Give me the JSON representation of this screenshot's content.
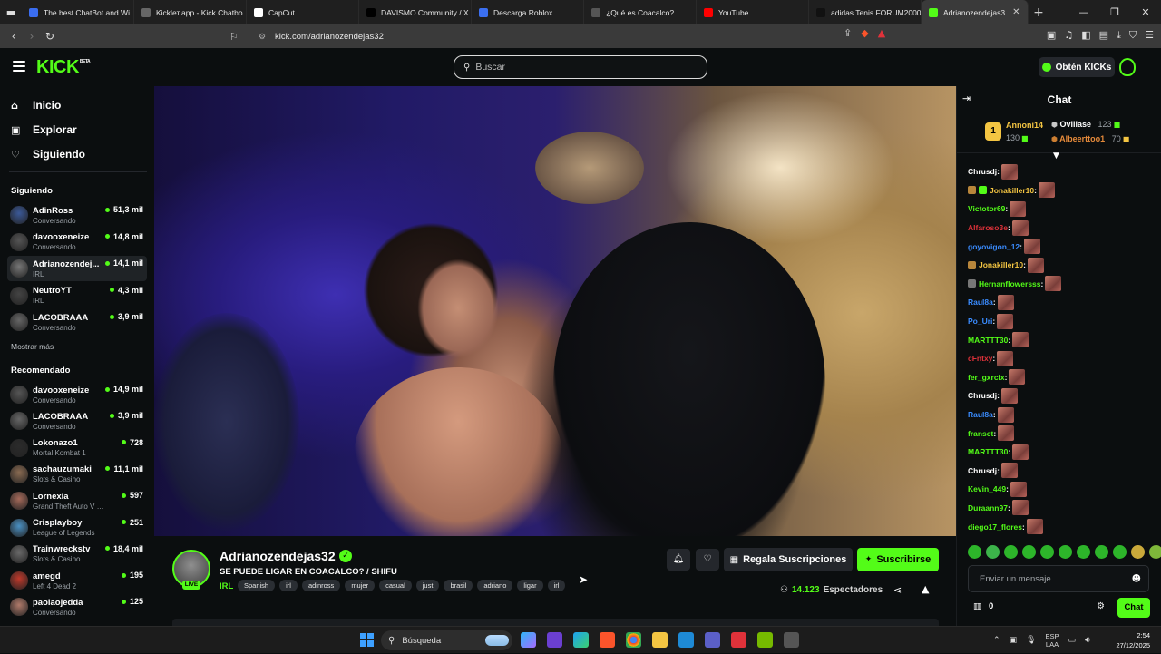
{
  "browser": {
    "tabs": [
      {
        "label": "The best ChatBot and Wi",
        "icon": "shield-icon",
        "color": "#3a6df0"
      },
      {
        "label": "Kickleт.app - Kick Chatbo",
        "icon": "kickletapp-icon",
        "color": "#666666"
      },
      {
        "label": "CapCut",
        "icon": "capcut-icon",
        "color": "#ffffff"
      },
      {
        "label": "DAVISMO Community / X",
        "icon": "x-icon",
        "color": "#000000"
      },
      {
        "label": "Descarga Roblox",
        "icon": "roblox-icon",
        "color": "#3b6ff0"
      },
      {
        "label": "¿Qué es Coacalco?",
        "icon": "globe-icon",
        "color": "#555555"
      },
      {
        "label": "YouTube",
        "icon": "youtube-icon",
        "color": "#ff0000"
      },
      {
        "label": "adidas Tenis FORUM2000",
        "icon": "adidas-icon",
        "color": "#111111"
      },
      {
        "label": "Adrianozendejas3",
        "icon": "kick-icon",
        "color": "#53fc18"
      }
    ],
    "url": "kick.com/adrianozendejas32"
  },
  "header": {
    "logo": "KICK",
    "logo_sup": "BETA",
    "search_placeholder": "Buscar",
    "kicks_label": "Obtén KICKs"
  },
  "sidebar": {
    "nav": [
      {
        "label": "Inicio",
        "icon": "home-icon"
      },
      {
        "label": "Explorar",
        "icon": "compass-icon"
      },
      {
        "label": "Siguiendo",
        "icon": "heart-icon"
      }
    ],
    "following_title": "Siguiendo",
    "following": [
      {
        "name": "AdinRoss",
        "category": "Conversando",
        "viewers": "51,3 mil",
        "avatar": "#3b5998"
      },
      {
        "name": "davooxeneize",
        "category": "Conversando",
        "viewers": "14,8 mil",
        "avatar": "#555555"
      },
      {
        "name": "Adrianozendej...",
        "category": "IRL",
        "viewers": "14,1 mil",
        "avatar": "#777777"
      },
      {
        "name": "NeutroYT",
        "category": "IRL",
        "viewers": "4,3 mil",
        "avatar": "#444444"
      },
      {
        "name": "LACOBRAAA",
        "category": "Conversando",
        "viewers": "3,9 mil",
        "avatar": "#666666"
      }
    ],
    "show_more": "Mostrar más",
    "recommended_title": "Recomendado",
    "recommended": [
      {
        "name": "davooxeneize",
        "category": "Conversando",
        "viewers": "14,9 mil",
        "avatar": "#555555"
      },
      {
        "name": "LACOBRAAA",
        "category": "Conversando",
        "viewers": "3,9 mil",
        "avatar": "#666666"
      },
      {
        "name": "Lokonazo1",
        "category": "Mortal Kombat 1",
        "viewers": "728",
        "avatar": "#2b2b2b"
      },
      {
        "name": "sachauzumaki",
        "category": "Slots & Casino",
        "viewers": "11,1 mil",
        "avatar": "#8a6b52"
      },
      {
        "name": "Lornexia",
        "category": "Grand Theft Auto V (G...",
        "viewers": "597",
        "avatar": "#a56a5a"
      },
      {
        "name": "Crisplayboy",
        "category": "League of Legends",
        "viewers": "251",
        "avatar": "#4a90c2"
      },
      {
        "name": "Trainwreckstv",
        "category": "Slots & Casino",
        "viewers": "18,4 mil",
        "avatar": "#6a6a6a"
      },
      {
        "name": "amegd",
        "category": "Left 4 Dead 2",
        "viewers": "195",
        "avatar": "#c0392b"
      },
      {
        "name": "paolaojedda",
        "category": "Conversando",
        "viewers": "125",
        "avatar": "#b07a6a"
      }
    ]
  },
  "stream": {
    "streamer": "Adrianozendejas32",
    "title": "SE PUEDE LIGAR EN COACALCO? / SHIFU",
    "category": "IRL",
    "live_label": "LIVE",
    "tags": [
      "Spanish",
      "irl",
      "adinross",
      "mujer",
      "casual",
      "just",
      "brasil",
      "adriano",
      "ligar",
      "irl"
    ],
    "gift_label": "Regala Suscripciones",
    "subscribe_label": "Suscribirse",
    "viewers": "14.123",
    "viewers_label": "Espectadores"
  },
  "chat": {
    "title": "Chat",
    "leaderboard": {
      "rank": "1",
      "first": {
        "name": "Annoni14",
        "value": "130"
      },
      "second": {
        "name": "Ovillase",
        "value": "123"
      },
      "third": {
        "name": "Albeerttoo1",
        "value": "70"
      }
    },
    "messages": [
      {
        "user": "Chrusdj",
        "color": "#ffffff",
        "badges": []
      },
      {
        "user": "Jonakiller10",
        "color": "#f4c542",
        "badges": [
          "#b8863b",
          "#53fc18"
        ]
      },
      {
        "user": "Victotor69",
        "color": "#53fc18",
        "badges": []
      },
      {
        "user": "Alfaroso3e",
        "color": "#e0323a",
        "badges": []
      },
      {
        "user": "goyovigon_12",
        "color": "#3a8cff",
        "badges": []
      },
      {
        "user": "Jonakiller10",
        "color": "#f4c542",
        "badges": [
          "#b8863b"
        ]
      },
      {
        "user": "Hernanflowersss",
        "color": "#53fc18",
        "badges": [
          "#777777"
        ]
      },
      {
        "user": "Raul8a",
        "color": "#3a8cff",
        "badges": []
      },
      {
        "user": "Po_Uri",
        "color": "#3a8cff",
        "badges": []
      },
      {
        "user": "MARTTT30",
        "color": "#53fc18",
        "badges": []
      },
      {
        "user": "cFntxy",
        "color": "#e0323a",
        "badges": []
      },
      {
        "user": "fer_gxrcix",
        "color": "#53fc18",
        "badges": []
      },
      {
        "user": "Chrusdj",
        "color": "#ffffff",
        "badges": []
      },
      {
        "user": "Raul8a",
        "color": "#3a8cff",
        "badges": []
      },
      {
        "user": "fransct",
        "color": "#53fc18",
        "badges": []
      },
      {
        "user": "MARTTT30",
        "color": "#53fc18",
        "badges": []
      },
      {
        "user": "Chrusdj",
        "color": "#ffffff",
        "badges": []
      },
      {
        "user": "Kevin_449",
        "color": "#53fc18",
        "badges": []
      },
      {
        "user": "Duraann97",
        "color": "#53fc18",
        "badges": []
      },
      {
        "user": "diego17_flores",
        "color": "#53fc18",
        "badges": []
      }
    ],
    "input_placeholder": "Enviar un mensaje",
    "points": "0",
    "send_label": "Chat"
  },
  "taskbar": {
    "search_label": "Búsqueda",
    "lang_top": "ESP",
    "lang_bottom": "LAA",
    "time": "2:54",
    "date": "27/12/2025"
  }
}
